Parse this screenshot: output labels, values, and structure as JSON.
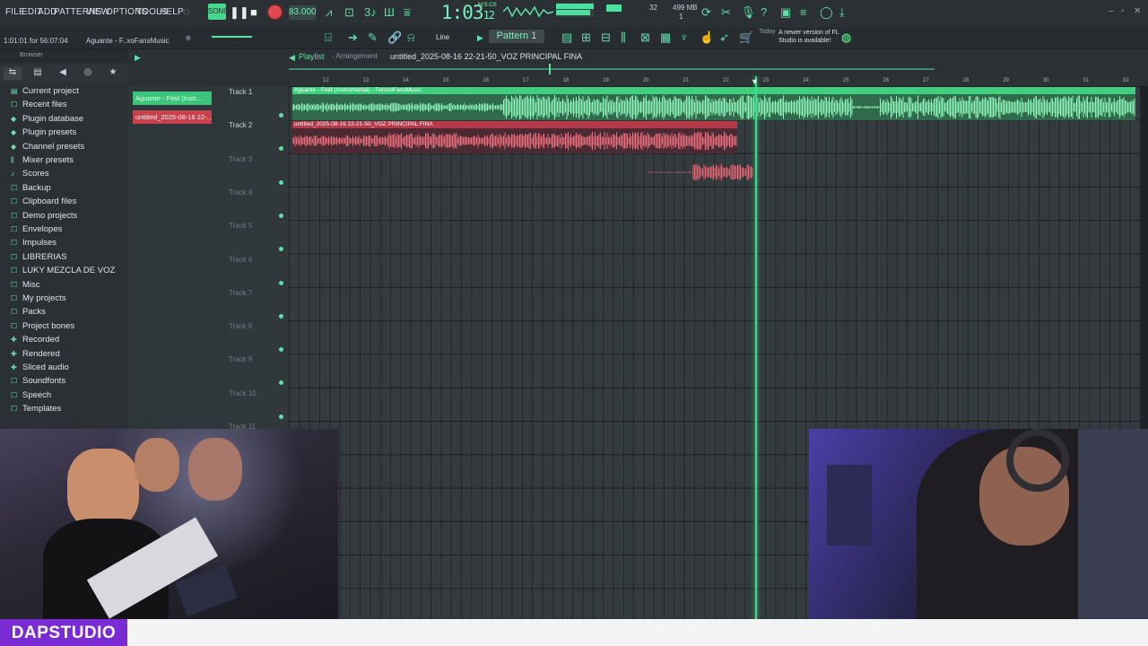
{
  "menu": [
    "FILE",
    "EDIT",
    "ADD",
    "PATTERNS",
    "VIEW",
    "OPTIONS",
    "TOOLS",
    "HELP"
  ],
  "transport": {
    "tempo": "83.000",
    "time": "1:03",
    "time_small": "12",
    "time_unit": "M:S:CS",
    "cpu": "32",
    "ram": "499 MB",
    "ram2": "1"
  },
  "hint": {
    "position": "1:01:01 for 56:07:04",
    "name": "Aguante - F..xoFansMusic"
  },
  "toolbar": {
    "snap": "Line",
    "pattern": "Pattern 1"
  },
  "news": {
    "date": "Today",
    "text": "A newer version of FL Studio is available!"
  },
  "browser": {
    "title": "Browser",
    "items": [
      {
        "label": "Current project",
        "icon": "project-icon"
      },
      {
        "label": "Recent files",
        "icon": "folder-icon"
      },
      {
        "label": "Plugin database",
        "icon": "plugin-icon"
      },
      {
        "label": "Plugin presets",
        "icon": "plugin-icon"
      },
      {
        "label": "Channel presets",
        "icon": "plugin-icon"
      },
      {
        "label": "Mixer presets",
        "icon": "mixer-icon"
      },
      {
        "label": "Scores",
        "icon": "note-icon"
      },
      {
        "label": "Backup",
        "icon": "folder-icon"
      },
      {
        "label": "Clipboard files",
        "icon": "folder-icon"
      },
      {
        "label": "Demo projects",
        "icon": "folder-icon"
      },
      {
        "label": "Envelopes",
        "icon": "folder-icon"
      },
      {
        "label": "Impulses",
        "icon": "folder-icon"
      },
      {
        "label": "LIBRERIAS",
        "icon": "folder-icon"
      },
      {
        "label": "LUKY MEZCLA DE VOZ",
        "icon": "folder-icon"
      },
      {
        "label": "Misc",
        "icon": "folder-icon"
      },
      {
        "label": "My projects",
        "icon": "folder-icon"
      },
      {
        "label": "Packs",
        "icon": "folder-icon"
      },
      {
        "label": "Project bones",
        "icon": "folder-icon"
      },
      {
        "label": "Recorded",
        "icon": "plus-icon"
      },
      {
        "label": "Rendered",
        "icon": "plus-icon"
      },
      {
        "label": "Sliced audio",
        "icon": "plus-icon"
      },
      {
        "label": "Soundfonts",
        "icon": "folder-icon"
      },
      {
        "label": "Speech",
        "icon": "folder-icon"
      },
      {
        "label": "Templates",
        "icon": "folder-icon"
      }
    ]
  },
  "channels": [
    {
      "label": "Aguante - Feid (Instr...",
      "color": "#3cc47a"
    },
    {
      "label": "untitled_2025-08-16 22-...",
      "color": "#c9414d"
    }
  ],
  "playlist": {
    "title": "Playlist",
    "subtitle": "- Arrangement",
    "name": "untitled_2025-08-16 22-21-50_VOZ PRINCIPAL FINA",
    "ruler": [
      "12",
      "13",
      "14",
      "15",
      "16",
      "17",
      "18",
      "19",
      "20",
      "21",
      "22",
      "23",
      "24",
      "25",
      "26",
      "27",
      "28",
      "29",
      "30",
      "31",
      "32"
    ],
    "tracks": [
      "Track 1",
      "Track 2",
      "Track 3",
      "Track 4",
      "Track 5",
      "Track 6",
      "Track 7",
      "Track 8",
      "Track 9",
      "Track 10",
      "Track 11"
    ],
    "clips": {
      "c1": "Aguante - Feid (Instrumental) - FerxxoFansMusic",
      "c2": "untitled_2025-08-16 22-21-50_VOZ PRINCIPAL FINA"
    }
  },
  "brand": "DAPSTUDIO"
}
